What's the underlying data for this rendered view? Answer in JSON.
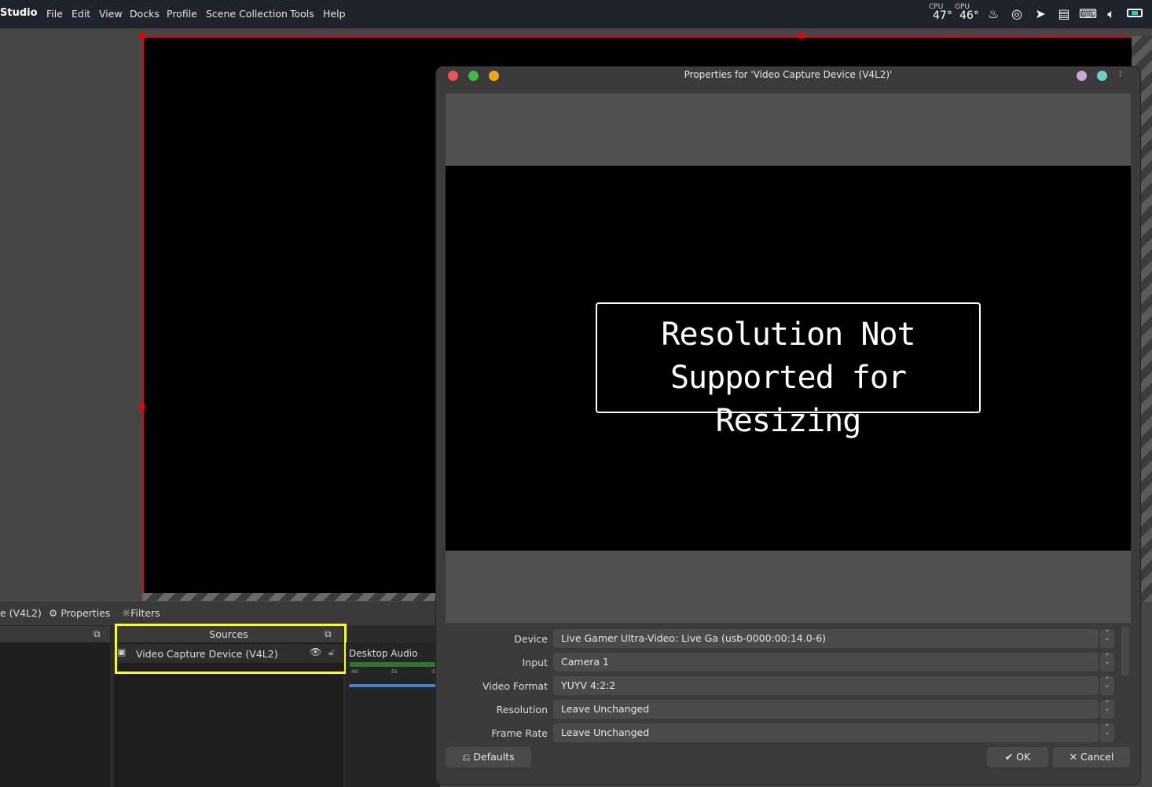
{
  "app": {
    "name": "Studio"
  },
  "menu": [
    "File",
    "Edit",
    "View",
    "Docks",
    "Profile",
    "Scene Collection",
    "Tools",
    "Help"
  ],
  "tray": {
    "cpu_label": "CPU",
    "cpu_temp": "47°",
    "gpu_label": "GPU",
    "gpu_temp": "46°",
    "icons": [
      "flame-icon",
      "obs-icon",
      "telegram-icon",
      "clipboard-icon",
      "keyboard-icon",
      "volume-icon",
      "battery-icon"
    ]
  },
  "toolbar": {
    "source_name": "e (V4L2)",
    "properties": "Properties",
    "filters": "Filters"
  },
  "sources": {
    "title": "Sources",
    "items": [
      {
        "name": "Video Capture Device (V4L2)"
      }
    ]
  },
  "mixer": {
    "channel": "Desktop Audio",
    "ticks": [
      "-60",
      "-55",
      "-5"
    ]
  },
  "dialog": {
    "title": "Properties for 'Video Capture Device (V4L2)'",
    "message_line1": "Resolution Not",
    "message_line2": "Supported for Resizing",
    "fields": [
      {
        "label": "Device",
        "value": "Live Gamer Ultra-Video: Live Ga (usb-0000:00:14.0-6)"
      },
      {
        "label": "Input",
        "value": "Camera 1"
      },
      {
        "label": "Video Format",
        "value": "YUYV 4:2:2"
      },
      {
        "label": "Resolution",
        "value": "Leave Unchanged"
      },
      {
        "label": "Frame Rate",
        "value": "Leave Unchanged"
      }
    ],
    "defaults": "Defaults",
    "ok": "OK",
    "cancel": "Cancel"
  },
  "colors": {
    "highlight": "#ffff00",
    "selection": "#ee0000",
    "close": "#ec5454",
    "max": "#3fbf3f",
    "min": "#f0a818"
  }
}
